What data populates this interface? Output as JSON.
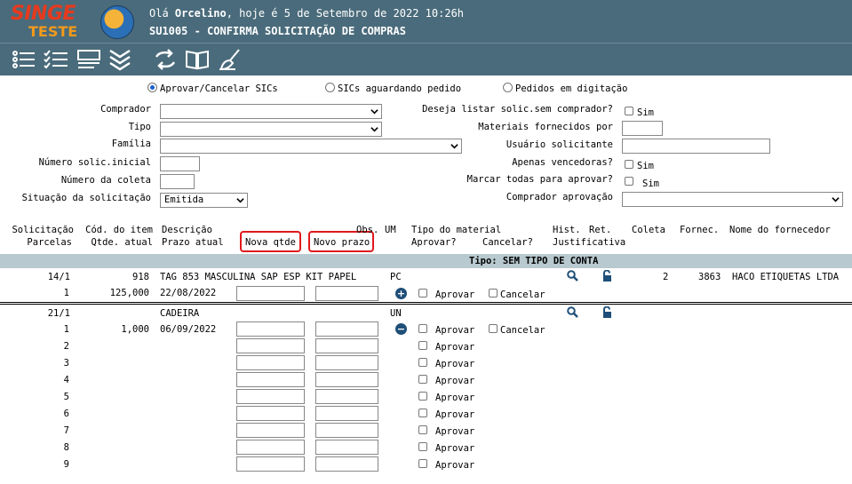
{
  "header": {
    "logo_top": "SINGE",
    "logo_bottom": "TESTE",
    "greeting_prefix": "Olá",
    "user": "Orcelino",
    "greeting_suffix": ", hoje é 5 de Setembro de 2022 10:26h",
    "screen_title": "SU1005 - CONFIRMA SOLICITAÇÃO DE COMPRAS"
  },
  "toolbar": [
    "list-icon",
    "checklist-icon",
    "form-icon",
    "chevrons-down-icon",
    "refresh-icon",
    "book-icon",
    "broom-icon"
  ],
  "radios": {
    "opt1": "Aprovar/Cancelar SICs",
    "opt2": "SICs aguardando pedido",
    "opt3": "Pedidos em digitação"
  },
  "filters": {
    "comprador": "Comprador",
    "tipo": "Tipo",
    "familia": "Família",
    "num_inicial": "Número solic.inicial",
    "num_coleta": "Número da coleta",
    "situacao": "Situação da solicitação",
    "situacao_value": "Emitida",
    "listar_sem": "Deseja listar solic.sem comprador?",
    "materiais": "Materiais fornecidos por",
    "usuario": "Usuário solicitante",
    "vencedoras": "Apenas vencedoras?",
    "marcar": "Marcar todas para aprovar?",
    "comprador_aprov": "Comprador aprovação",
    "sim": "Sim"
  },
  "columns": {
    "solicitacao": "Solicitação",
    "parcelas": "Parcelas",
    "cod_item": "Cód. do item",
    "qtde_atual": "Qtde. atual",
    "descricao": "Descrição",
    "prazo_atual": "Prazo atual",
    "nova_qtde": "Nova qtde",
    "novo_prazo": "Novo prazo",
    "obs": "Obs.",
    "um": "UM",
    "tipo_material": "Tipo do material",
    "aprovar": "Aprovar?",
    "cancelar": "Cancelar?",
    "hist": "Hist.",
    "ret": "Ret.",
    "justificativa": "Justificativa",
    "coleta": "Coleta",
    "fornec": "Fornec.",
    "nome_fornecedor": "Nome do fornecedor"
  },
  "tipo_header": "Tipo: SEM TIPO DE CONTA",
  "labels": {
    "aprovar": "Aprovar",
    "cancelar": "Cancelar"
  },
  "sic1": {
    "solic": "14/1",
    "item": "918",
    "descricao": "TAG 853 MASCULINA SAP ESP KIT PAPEL",
    "um": "PC",
    "coleta": "2",
    "fornec": "3863",
    "nome": "HACO ETIQUETAS LTDA",
    "parcela": "1",
    "qtde": "125,000",
    "prazo": "22/08/2022"
  },
  "sic2": {
    "solic": "21/1",
    "descricao": "CADEIRA",
    "um": "UN",
    "parcelas": [
      "1",
      "2",
      "3",
      "4",
      "5",
      "6",
      "7",
      "8",
      "9"
    ],
    "qtde": "1,000",
    "prazo": "06/09/2022"
  }
}
